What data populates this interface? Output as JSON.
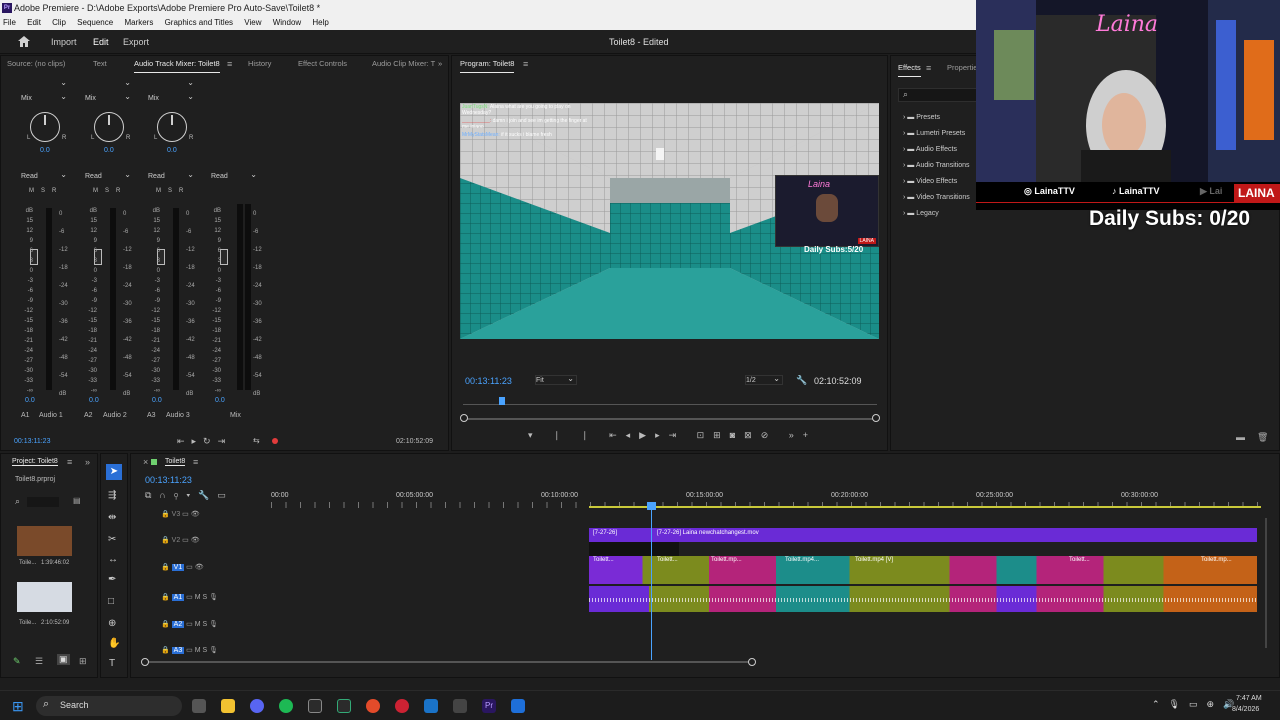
{
  "window": {
    "title": "Adobe Premiere - D:\\Adobe Exports\\Adobe Premiere Pro Auto-Save\\Toilet8 *",
    "app_icon": "Pr"
  },
  "menubar": [
    "File",
    "Edit",
    "Clip",
    "Sequence",
    "Markers",
    "Graphics and Titles",
    "View",
    "Window",
    "Help"
  ],
  "topnav": {
    "import": "Import",
    "edit": "Edit",
    "export": "Export",
    "doc_title": "Toilet8 - Edited"
  },
  "source_panel": {
    "tabs": [
      "Source: (no clips)",
      "Text",
      "Audio Track Mixer: Toilet8",
      "History",
      "Effect Controls",
      "Audio Clip Mixer: T"
    ],
    "channels": [
      {
        "mode": "Mix",
        "pan": "0.0",
        "automation": "Read",
        "id": "A1",
        "name": "Audio 1",
        "level": "0.0"
      },
      {
        "mode": "Mix",
        "pan": "0.0",
        "automation": "Read",
        "id": "A2",
        "name": "Audio 2",
        "level": "0.0"
      },
      {
        "mode": "Mix",
        "pan": "0.0",
        "automation": "Read",
        "id": "A3",
        "name": "Audio 3",
        "level": "0.0"
      },
      {
        "mode": "",
        "pan": "",
        "automation": "Read",
        "id": "",
        "name": "Mix",
        "level": "0.0"
      }
    ],
    "msr": [
      "M",
      "S",
      "R"
    ],
    "left_scale": [
      "dB",
      "15",
      "12",
      "9",
      "6",
      "3",
      "0",
      "-3",
      "-6",
      "-9",
      "-12",
      "-15",
      "-18",
      "-21",
      "-24",
      "-27",
      "-30",
      "-33",
      "-∞"
    ],
    "right_scale": [
      "0",
      "-6",
      "-12",
      "-18",
      "-24",
      "-30",
      "-36",
      "-42",
      "-48",
      "-54",
      "dB"
    ],
    "timecode": "00:13:11:23",
    "end_timecode": "02:10:52:09"
  },
  "program_panel": {
    "tab": "Program: Toilet8",
    "timecode": "00:13:11:23",
    "fit": "Fit",
    "resolution": "1/2",
    "duration": "02:10:52:09",
    "chat": [
      {
        "user": "JuanTugsN:",
        "msg": "Alaina what are you going to play on Wednesday?"
      },
      {
        "user": "__________:",
        "msg": "damn i join and see im getting the finger at me iniaoo"
      },
      {
        "user": "MrMyStatsMean:",
        "msg": "if it sucks i blame fresh"
      }
    ],
    "inset_cam": {
      "name": "Laina",
      "subs": "Daily Subs:5/20",
      "tag": "LAINA"
    }
  },
  "effects_panel": {
    "tabs": [
      "Effects",
      "Properties"
    ],
    "items": [
      "Presets",
      "Lumetri Presets",
      "Audio Effects",
      "Audio Transitions",
      "Video Effects",
      "Video Transitions",
      "Legacy"
    ]
  },
  "webcam": {
    "neon_name": "Laina",
    "socials": [
      "LainaTTV",
      "LainaTTV",
      "Lai"
    ],
    "banner": "LAINA",
    "subs": "Daily Subs: 0/20"
  },
  "project_panel": {
    "tab": "Project: Toilet8",
    "file": "Toilet8.prproj",
    "items": [
      {
        "name": "Toile...",
        "duration": "1:39:46:02"
      },
      {
        "name": "Toile...",
        "duration": "2:10:52:09"
      }
    ]
  },
  "timeline": {
    "tab": "Toilet8",
    "timecode": "00:13:11:23",
    "ruler": [
      "00:00",
      "00:05:00:00",
      "00:10:00:00",
      "00:15:00:00",
      "00:20:00:00",
      "00:25:00:00",
      "00:30:00:00"
    ],
    "tracks": [
      {
        "id": "V3",
        "type": "video"
      },
      {
        "id": "V2",
        "type": "video"
      },
      {
        "id": "V1",
        "type": "video"
      },
      {
        "id": "A1",
        "type": "audio"
      },
      {
        "id": "A2",
        "type": "audio"
      },
      {
        "id": "A3",
        "type": "audio"
      }
    ],
    "track_ms": [
      "M",
      "S"
    ],
    "v2_clips": [
      "[7-27-26]",
      "[7-27-26] Laina newchatchangest.mov"
    ],
    "v1_clips": [
      "Toilett...",
      "Toilett...",
      "Toilett.mp...",
      "Toilett.mp4...",
      "Toilett.mp4 [V]",
      "Toilett...",
      "Toilett.mp..."
    ]
  },
  "taskbar": {
    "search": "Search",
    "time": "7:47 AM",
    "date": "8/4/2026"
  },
  "colors": {
    "accent": "#4aa3ff",
    "purple_clip": "#6a2bd6",
    "olive_clip": "#7c8b1e",
    "magenta_clip": "#b4247a",
    "teal_clip": "#1c8d8a",
    "playhead": "#4aa3ff"
  }
}
